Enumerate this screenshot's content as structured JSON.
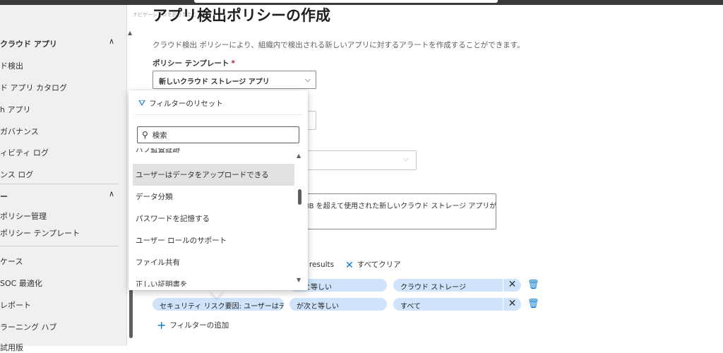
{
  "sidebar": {
    "items": [
      {
        "label": "クラウド アプリ",
        "head": true,
        "chevron": "∧"
      },
      {
        "label": "ド検出"
      },
      {
        "label": "ド アプリ カタログ"
      },
      {
        "label": "h アプリ"
      },
      {
        "label": " ガバナンス"
      },
      {
        "label": "ィビティ ログ"
      },
      {
        "label": "ンス ログ"
      },
      {
        "label": "ー",
        "head": true,
        "chevron": "∧"
      },
      {
        "label": "ポリシー管理"
      },
      {
        "label": "ポリシー テンプレート"
      },
      {
        "label": "ケース"
      },
      {
        "label": "SOC 最適化"
      },
      {
        "label": "レポート"
      },
      {
        "label": "ラーニング ハブ"
      },
      {
        "label": "試用版"
      }
    ]
  },
  "breadcrumb": "ナビゲーションを折りたたむ",
  "page": {
    "title": "アプリ検出ポリシーの作成",
    "description": "クラウド検出 ポリシーにより、組織内で検出される新しいアプリに対するアラートを作成することができます。",
    "template_label": "ポリシー テンプレート",
    "required_mark": "*",
    "template_value": "新しいクラウド ストレージ アプリ",
    "description_text": "MB を超えて使用された新しいクラウド ストレージ アプリが"
  },
  "filters": {
    "results_text": "w results",
    "clear_all_label": "すべてクリア",
    "rows": [
      {
        "field": "",
        "operator": "次と等しい",
        "value": "クラウド ストレージ"
      },
      {
        "field": "セキュリティ リスク要因: ユーザーはデー...",
        "operator": "が次と等しい",
        "value": "すべて"
      }
    ],
    "add_filter_label": "フィルターの追加"
  },
  "dropdown": {
    "reset_label": "フィルターのリセット",
    "search_placeholder": "検索",
    "items": [
      {
        "label": "ハフ監査証跡"
      },
      {
        "label": "ユーザーはデータをアップロードできる",
        "highlighted": true
      },
      {
        "label": "データ分類"
      },
      {
        "label": "パスワードを記憶する"
      },
      {
        "label": "ユーザー ロールのサポート"
      },
      {
        "label": "ファイル共有"
      },
      {
        "label": "正しい証明書を"
      }
    ]
  },
  "colors": {
    "accent": "#0078d4",
    "chip": "#cfe4fa",
    "sidebar_bg": "#f0f0f0",
    "highlight": "#e1e1e1"
  },
  "icons": {
    "filter_reset": "filter-reset-icon",
    "search": "search-icon",
    "clear": "close-icon",
    "delete": "trash-icon",
    "add": "plus-icon"
  }
}
